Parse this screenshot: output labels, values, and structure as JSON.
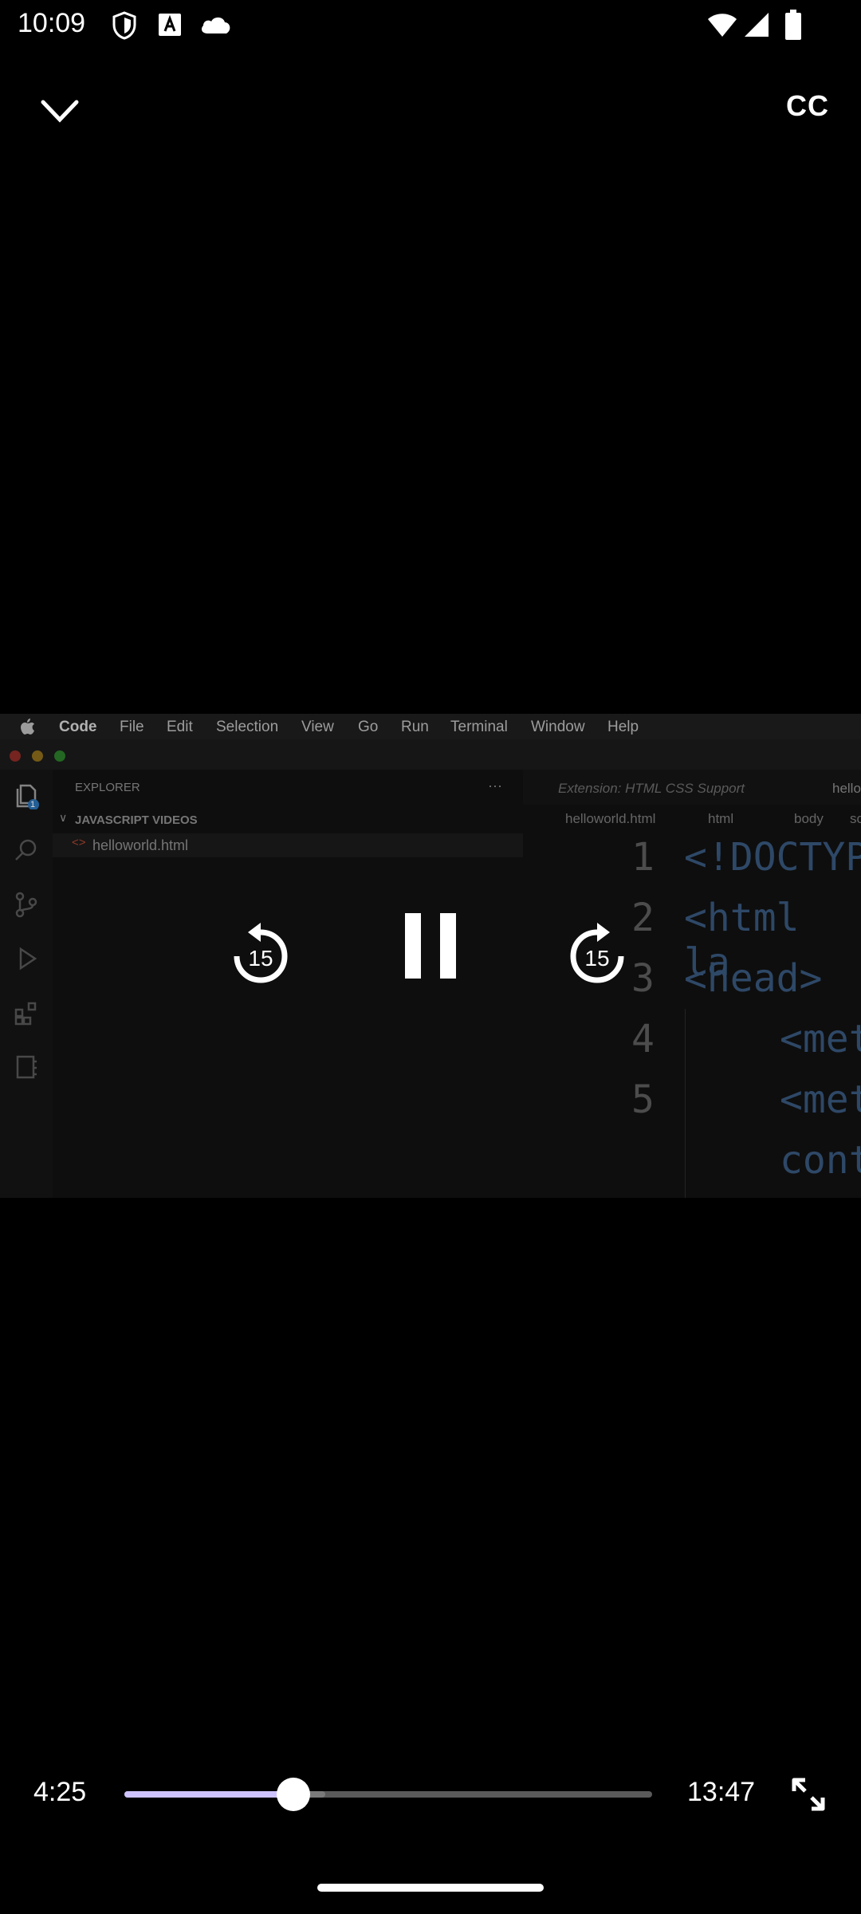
{
  "status_bar": {
    "time": "10:09",
    "icons": [
      "shield-icon",
      "font-a-icon",
      "cloud-icon",
      "wifi-icon",
      "signal-icon",
      "battery-icon"
    ]
  },
  "top_controls": {
    "collapse_icon": "chevron-down-icon",
    "cc_label": "CC"
  },
  "video_frame": {
    "menubar": {
      "app": "Code",
      "items": [
        "File",
        "Edit",
        "Selection",
        "View",
        "Go",
        "Run",
        "Terminal",
        "Window",
        "Help"
      ]
    },
    "explorer": {
      "title": "EXPLORER",
      "more": "···",
      "folder": "JAVASCRIPT VIDEOS",
      "file": "helloworld.html",
      "badge": "1"
    },
    "editor": {
      "tab_active": "Extension: HTML CSS Support",
      "tab_next": "hello",
      "breadcrumb": [
        "helloworld.html",
        "html",
        "body",
        "sc"
      ],
      "lines": [
        {
          "num": "1",
          "code": "<!DOCTYPE"
        },
        {
          "num": "2",
          "code": "<html la"
        },
        {
          "num": "3",
          "code": "<head>"
        },
        {
          "num": "4",
          "code": "<met"
        },
        {
          "num": "5",
          "code": "<met"
        },
        {
          "num": "",
          "code": "cont"
        }
      ]
    }
  },
  "playback": {
    "rewind_seconds": "15",
    "forward_seconds": "15",
    "pause_icon": "pause-icon"
  },
  "progress": {
    "elapsed": "4:25",
    "total": "13:47",
    "played_fraction": 0.32,
    "buffered_fraction": 0.38,
    "fullscreen_icon": "fullscreen-icon"
  },
  "colors": {
    "played": "#cfc3ff",
    "track": "#5a5a5a",
    "background": "#000000"
  }
}
